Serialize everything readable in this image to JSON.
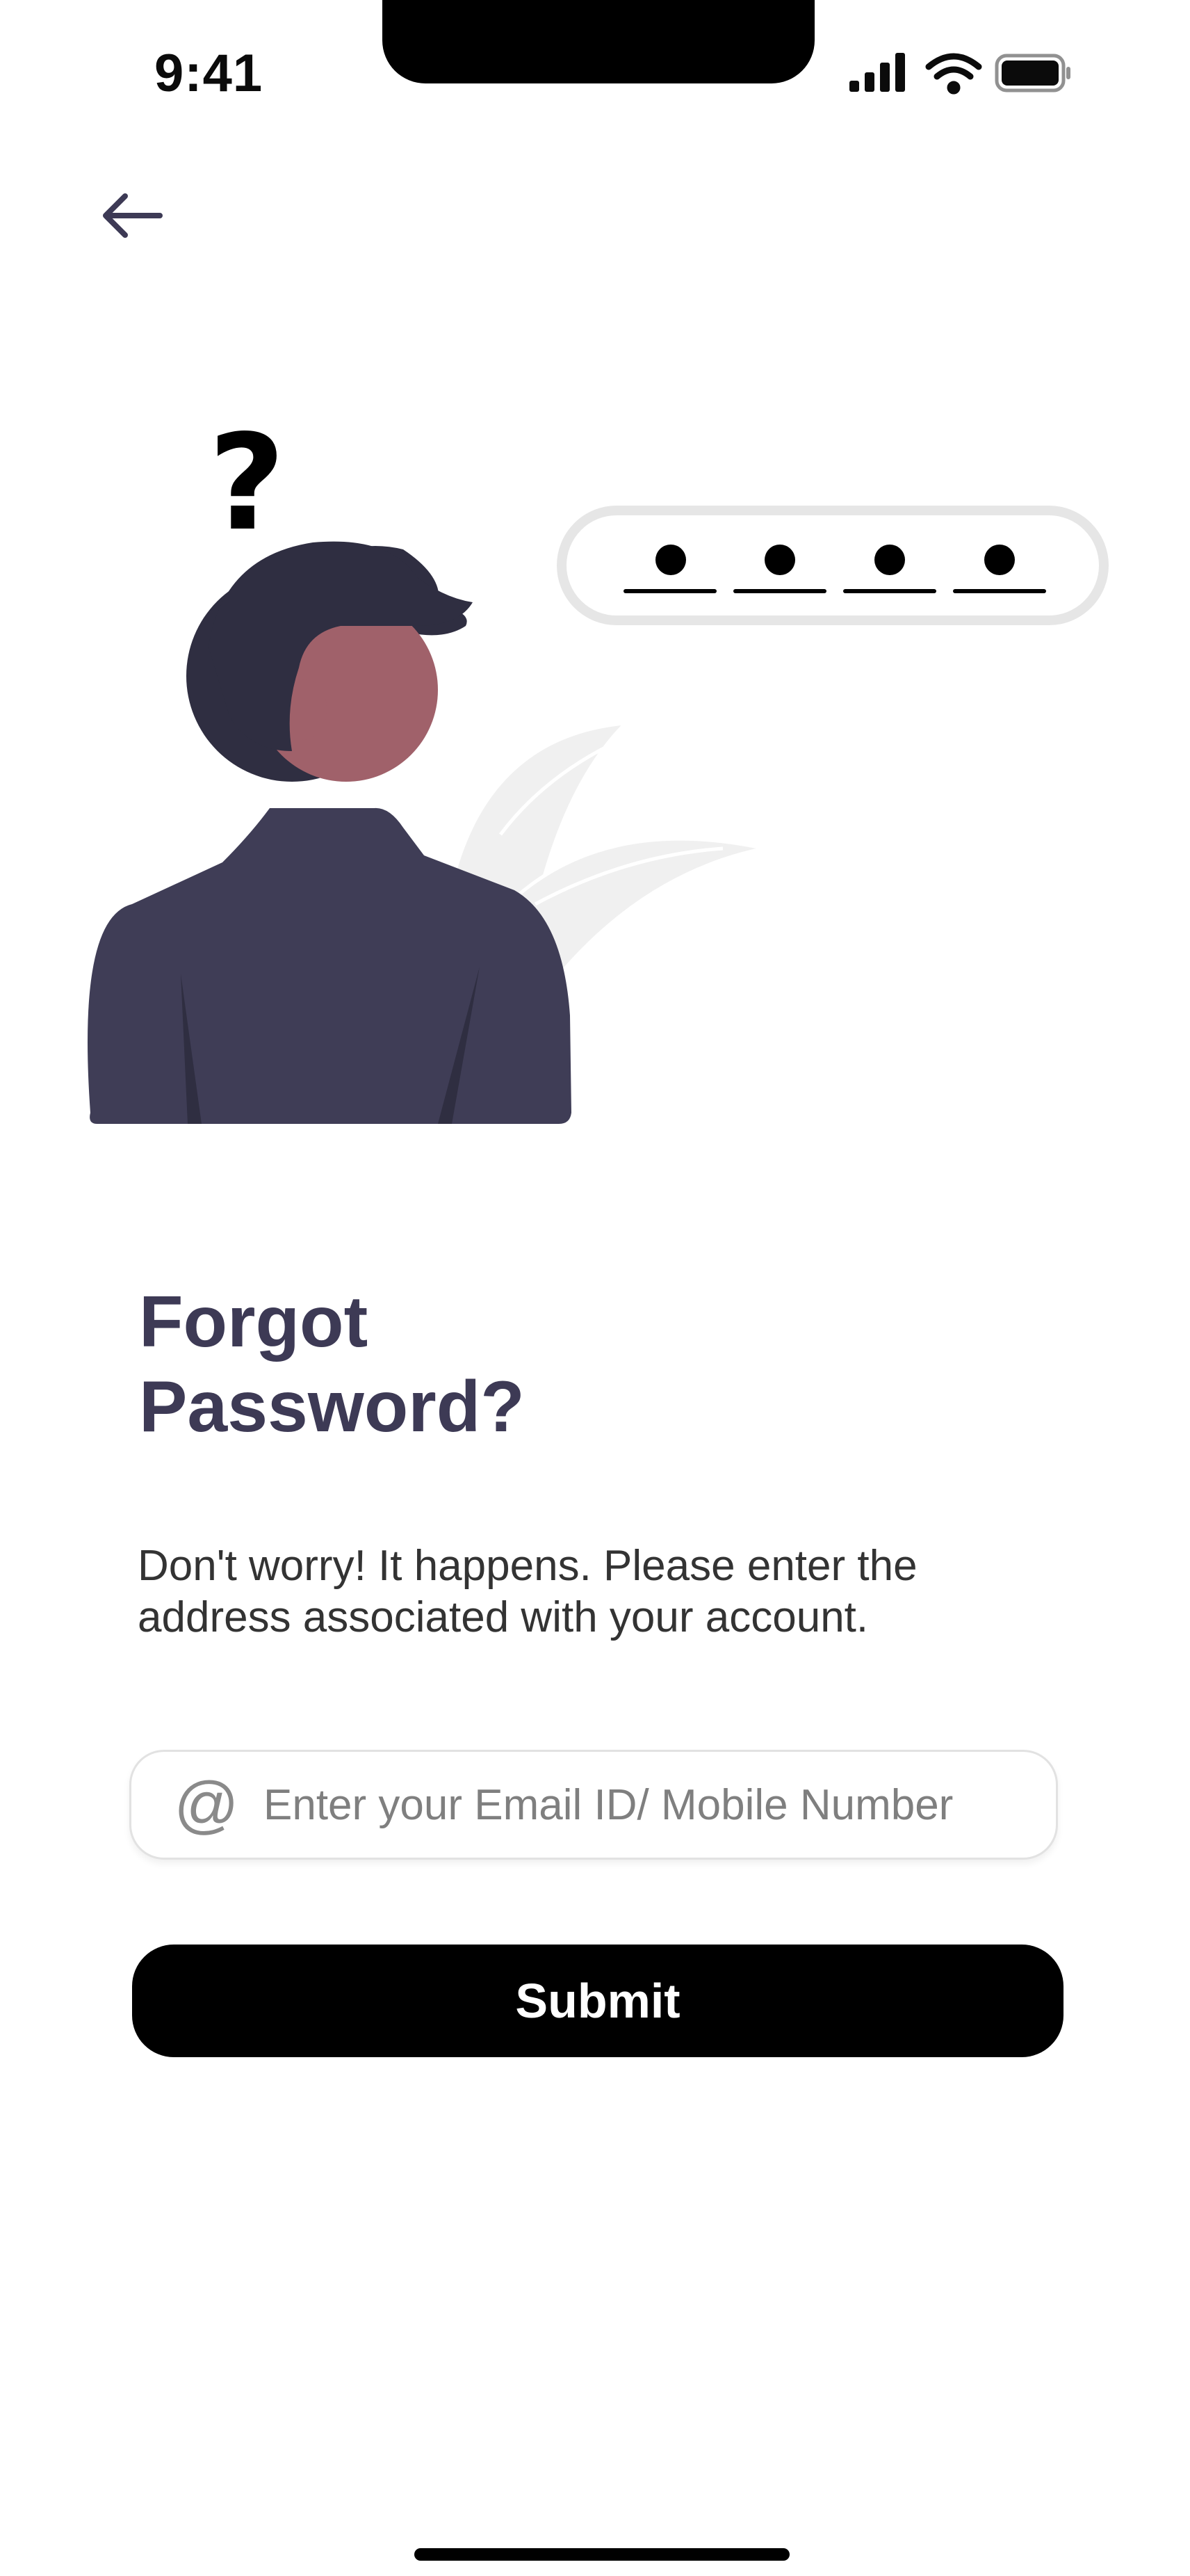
{
  "status_bar": {
    "time": "9:41",
    "icons": [
      "signal-icon",
      "wifi-icon",
      "battery-icon"
    ]
  },
  "nav": {
    "back_icon": "arrow-left-icon"
  },
  "illustration": {
    "question_mark": "?",
    "colors": {
      "hair": "#2f2e41",
      "skin": "#a0616a",
      "shirt": "#3f3d56",
      "leaf": "#f0f0f0",
      "pill_border": "#e6e6e6"
    }
  },
  "title": {
    "line1": "Forgot",
    "line2": "Password?"
  },
  "subtitle": "Don't worry! It happens. Please enter the address associated with your account.",
  "form": {
    "at_symbol": "@",
    "email_placeholder": "Enter your Email ID/ Mobile Number",
    "email_value": "",
    "submit_label": "Submit"
  },
  "colors": {
    "title": "#3d3a55",
    "button_bg": "#000000",
    "button_text": "#ffffff"
  }
}
